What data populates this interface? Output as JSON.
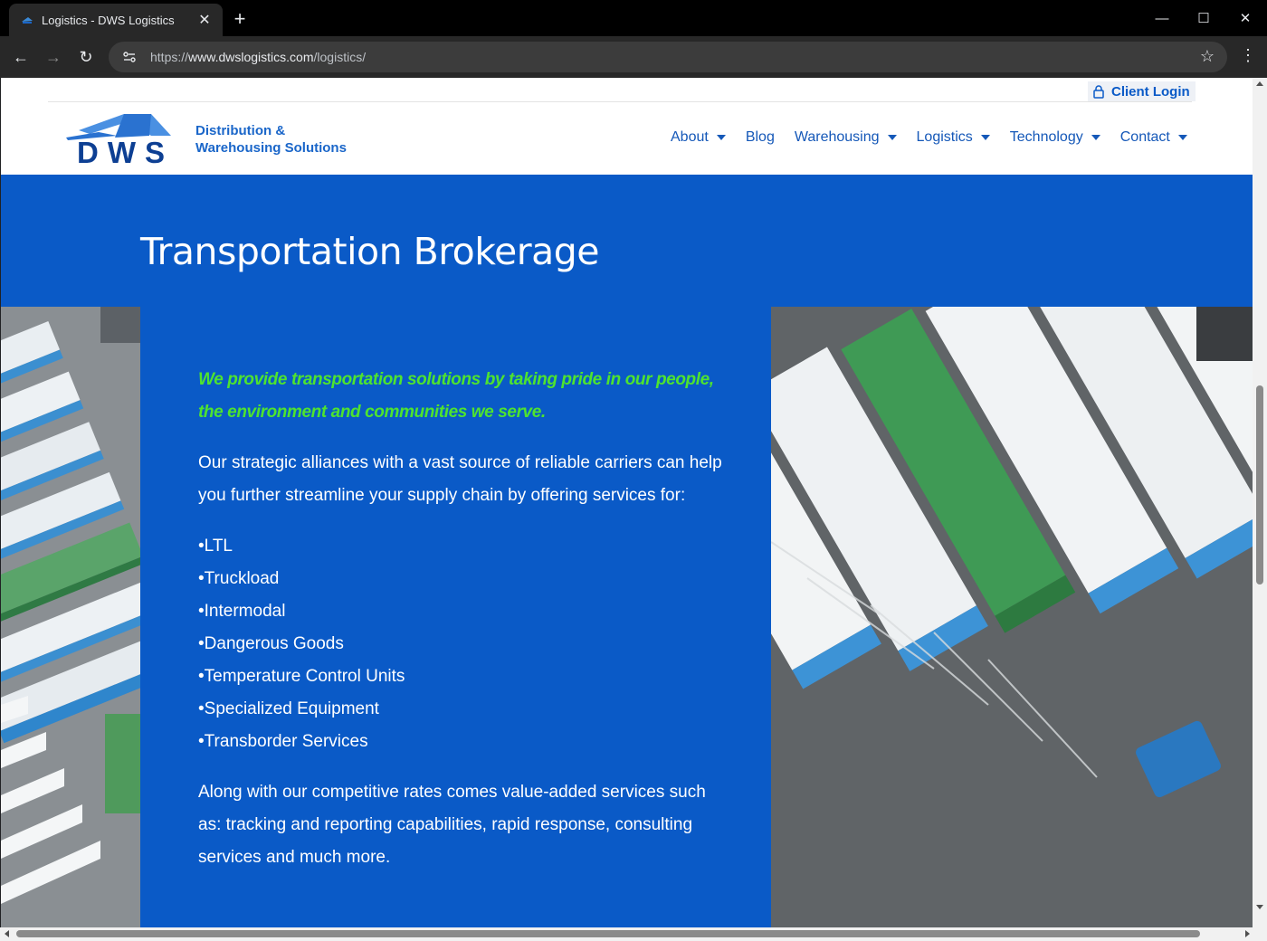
{
  "browser": {
    "tab_title": "Logistics - DWS Logistics",
    "url_scheme": "https://",
    "url_host": "www.dwslogistics.com",
    "url_path": "/logistics/"
  },
  "header": {
    "client_login": "Client Login",
    "logo_letters": "DWS",
    "logo_text_line1": "Distribution &",
    "logo_text_line2": "Warehousing Solutions",
    "nav": [
      {
        "label": "About",
        "dropdown": true
      },
      {
        "label": "Blog",
        "dropdown": false
      },
      {
        "label": "Warehousing",
        "dropdown": true
      },
      {
        "label": "Logistics",
        "dropdown": true
      },
      {
        "label": "Technology",
        "dropdown": true
      },
      {
        "label": "Contact",
        "dropdown": true
      }
    ]
  },
  "main": {
    "title": "Transportation Brokerage",
    "tagline": "We provide transportation solutions by taking pride in our people, the environment and communities we serve.",
    "intro": "Our strategic alliances with a vast source of reliable carriers can help you further streamline your supply chain by offering services for:",
    "services": [
      "LTL",
      "Truckload",
      "Intermodal",
      "Dangerous Goods",
      "Temperature Control Units",
      "Specialized Equipment",
      "Transborder Services"
    ],
    "closing": "Along with our competitive rates comes value-added services such as: tracking and reporting capabilities, rapid response, consulting services and much more."
  },
  "colors": {
    "brand_blue": "#0a5ac7",
    "tagline_green": "#4ee32f",
    "nav_blue": "#1558b8"
  }
}
